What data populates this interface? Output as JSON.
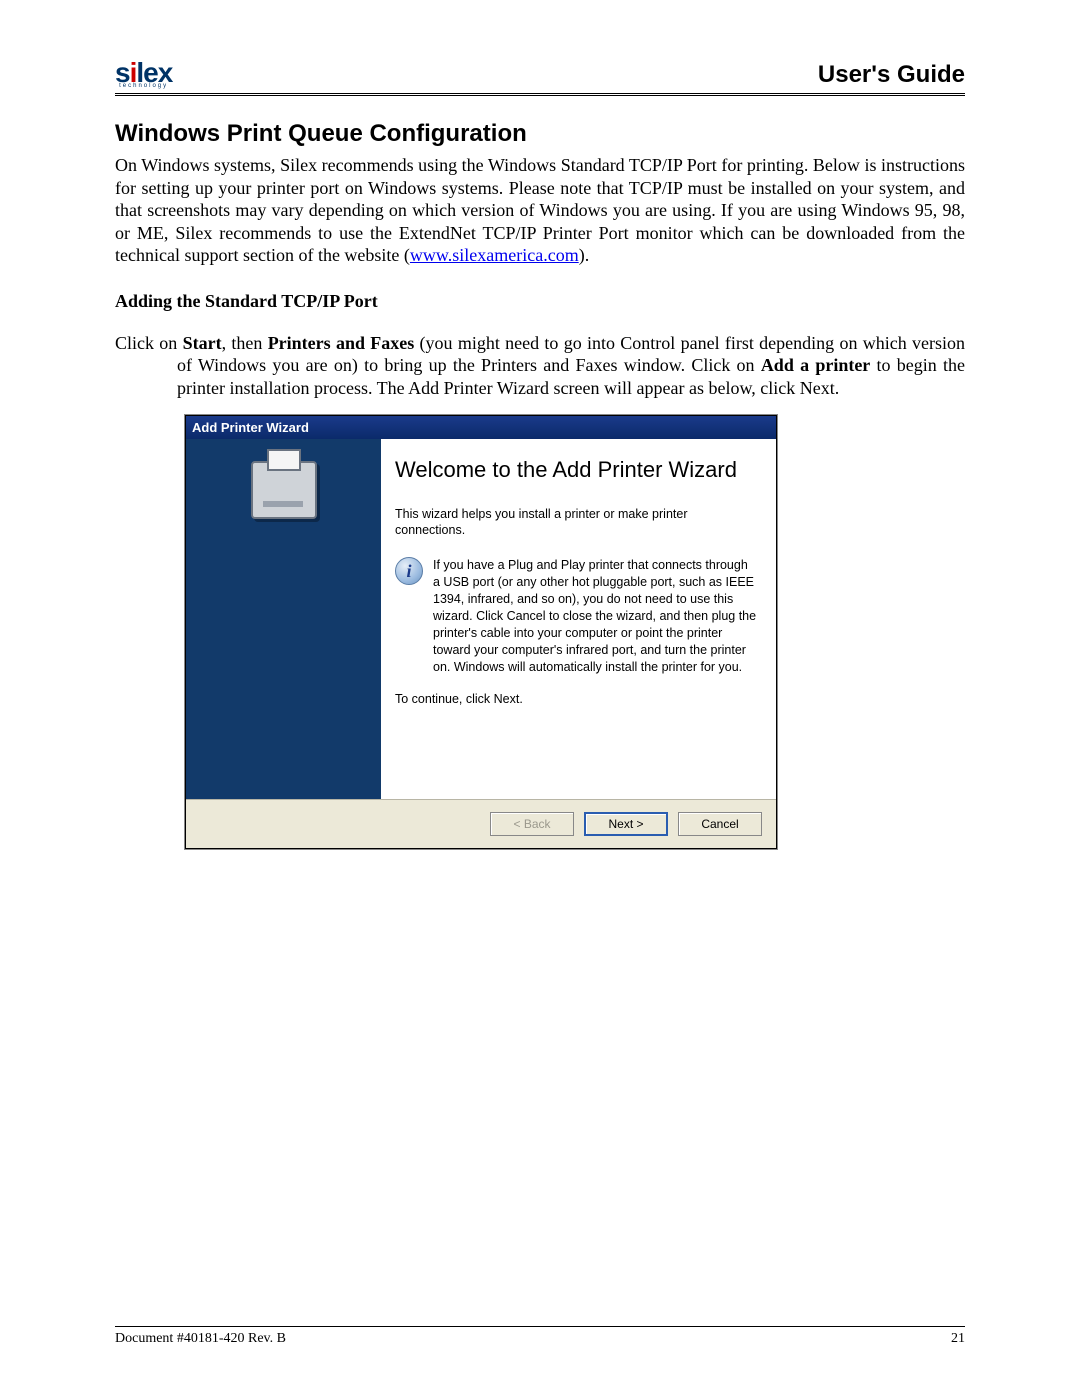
{
  "header": {
    "logo_text": "silex",
    "logo_sub": "technology",
    "guide_title": "User's Guide"
  },
  "section_title": "Windows Print Queue Configuration",
  "intro_pre": "On Windows systems, Silex recommends using the Windows Standard TCP/IP Port for printing. Below is instructions for setting up your printer port on Windows systems. Please note that TCP/IP must be installed on your system, and that screenshots may vary depending on which version of Windows you are using. If you are using Windows 95, 98, or ME, Silex recommends to use the ExtendNet TCP/IP Printer Port monitor which can be downloaded from the technical support section of the website (",
  "intro_link": "www.silexamerica.com",
  "intro_post": ").",
  "subsection_title": "Adding the Standard TCP/IP Port",
  "step": {
    "pre": "Click on ",
    "s1": "Start",
    "t1": ", then ",
    "s2": "Printers and Faxes",
    "t2": " (you might need to go into Control panel first depending on which version of Windows you are on) to bring up the Printers and Faxes window. Click on ",
    "s3": "Add a printer",
    "t3": " to begin the printer installation process. The Add Printer Wizard screen will appear as below, click Next."
  },
  "wizard": {
    "titlebar": "Add Printer Wizard",
    "heading": "Welcome to the Add Printer Wizard",
    "p1": "This wizard helps you install a printer or make printer connections.",
    "info": "If you have a Plug and Play printer that connects through a USB port (or any other hot pluggable port, such as IEEE 1394, infrared, and so on), you do not need to use this wizard. Click Cancel to close the wizard, and then plug the printer's cable into your computer or point the printer toward your computer's infrared port, and turn the printer on. Windows will automatically install the printer for you.",
    "continue": "To continue, click Next.",
    "buttons": {
      "back": "< Back",
      "next": "Next >",
      "cancel": "Cancel"
    }
  },
  "footer": {
    "doc": "Document #40181-420  Rev. B",
    "page": "21"
  }
}
